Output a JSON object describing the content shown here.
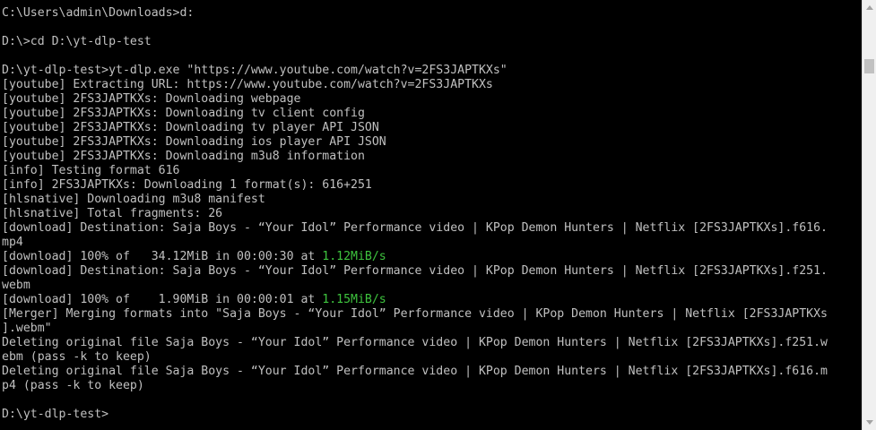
{
  "terminal": {
    "lines": [
      [
        {
          "text": "C:\\Users\\admin\\Downloads>d:"
        }
      ],
      [
        {
          "text": ""
        }
      ],
      [
        {
          "text": "D:\\>cd D:\\yt-dlp-test"
        }
      ],
      [
        {
          "text": ""
        }
      ],
      [
        {
          "text": "D:\\yt-dlp-test>yt-dlp.exe \"https://www.youtube.com/watch?v=2FS3JAPTKXs\""
        }
      ],
      [
        {
          "text": "[youtube] Extracting URL: https://www.youtube.com/watch?v=2FS3JAPTKXs"
        }
      ],
      [
        {
          "text": "[youtube] 2FS3JAPTKXs: Downloading webpage"
        }
      ],
      [
        {
          "text": "[youtube] 2FS3JAPTKXs: Downloading tv client config"
        }
      ],
      [
        {
          "text": "[youtube] 2FS3JAPTKXs: Downloading tv player API JSON"
        }
      ],
      [
        {
          "text": "[youtube] 2FS3JAPTKXs: Downloading ios player API JSON"
        }
      ],
      [
        {
          "text": "[youtube] 2FS3JAPTKXs: Downloading m3u8 information"
        }
      ],
      [
        {
          "text": "[info] Testing format 616"
        }
      ],
      [
        {
          "text": "[info] 2FS3JAPTKXs: Downloading 1 format(s): 616+251"
        }
      ],
      [
        {
          "text": "[hlsnative] Downloading m3u8 manifest"
        }
      ],
      [
        {
          "text": "[hlsnative] Total fragments: 26"
        }
      ],
      [
        {
          "text": "[download] Destination: Saja Boys - “Your Idol” Performance video | KPop Demon Hunters | Netflix [2FS3JAPTKXs].f616."
        }
      ],
      [
        {
          "text": "mp4"
        }
      ],
      [
        {
          "text": "[download] 100% of   34.12MiB in 00:00:30 at "
        },
        {
          "text": "1.12MiB/s",
          "color": "green"
        }
      ],
      [
        {
          "text": "[download] Destination: Saja Boys - “Your Idol” Performance video | KPop Demon Hunters | Netflix [2FS3JAPTKXs].f251."
        }
      ],
      [
        {
          "text": "webm"
        }
      ],
      [
        {
          "text": "[download] 100% of    1.90MiB in 00:00:01 at "
        },
        {
          "text": "1.15MiB/s",
          "color": "green"
        }
      ],
      [
        {
          "text": "[Merger] Merging formats into \"Saja Boys - “Your Idol” Performance video | KPop Demon Hunters | Netflix [2FS3JAPTKXs"
        }
      ],
      [
        {
          "text": "].webm\""
        }
      ],
      [
        {
          "text": "Deleting original file Saja Boys - “Your Idol” Performance video | KPop Demon Hunters | Netflix [2FS3JAPTKXs].f251.w"
        }
      ],
      [
        {
          "text": "ebm (pass -k to keep)"
        }
      ],
      [
        {
          "text": "Deleting original file Saja Boys - “Your Idol” Performance video | KPop Demon Hunters | Netflix [2FS3JAPTKXs].f616.m"
        }
      ],
      [
        {
          "text": "p4 (pass -k to keep)"
        }
      ],
      [
        {
          "text": ""
        }
      ],
      [
        {
          "text": "D:\\yt-dlp-test>"
        }
      ]
    ]
  },
  "colors": {
    "background": "#000000",
    "foreground": "#c0c0c0",
    "green": "#3ec43e"
  },
  "scrollbar": {
    "up_icon": "triangle-up-icon",
    "down_icon": "triangle-down-icon"
  }
}
